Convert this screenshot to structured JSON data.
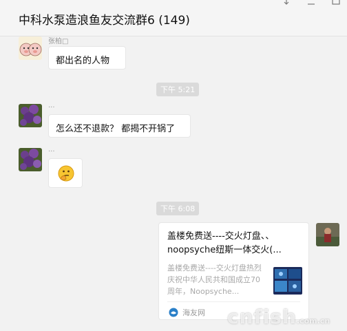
{
  "window": {
    "title": "中科水泵造浪鱼友交流群6 (149)",
    "controls": [
      "pin-icon",
      "minimize-icon",
      "maximize-icon"
    ]
  },
  "messages": [
    {
      "sender": "张柏□",
      "avatar": "cartoon-pig-avatar",
      "text": "都出名的人物"
    },
    {
      "time": "下午 5:21"
    },
    {
      "sender": "...",
      "avatar": "purple-flower-avatar",
      "text": "怎么还不退款？ 都揭不开锅了"
    },
    {
      "sender": "...",
      "avatar": "purple-flower-avatar",
      "emoji": "thinking-emoji"
    },
    {
      "time": "下午 6:08"
    }
  ],
  "link_card": {
    "title": "盖楼免费送----交火灯盘、、noopsyche纽斯一体交火(...",
    "description": "盖楼免费送----交火灯盘热烈庆祝中华人民共和国成立70周年，Noopsyche...",
    "source": "海友网",
    "avatar": "self-avatar"
  },
  "watermark": {
    "text": "cnfish",
    "suffix": ".com.cn"
  },
  "colors": {
    "background": "#f2f2f2",
    "bubble": "#ffffff",
    "time_pill": "#dadada"
  }
}
